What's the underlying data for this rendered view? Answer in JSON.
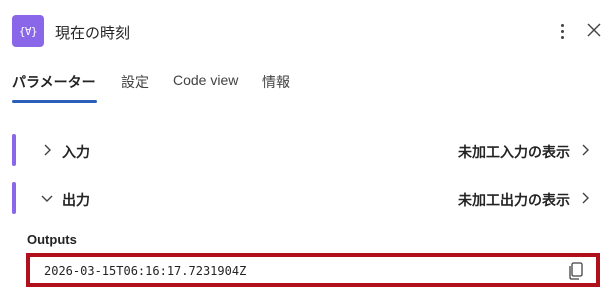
{
  "header": {
    "icon_text": "{∀}",
    "title": "現在の時刻"
  },
  "tabs": [
    {
      "label": "パラメーター",
      "active": true
    },
    {
      "label": "設定",
      "active": false
    },
    {
      "label": "Code view",
      "active": false
    },
    {
      "label": "情報",
      "active": false
    }
  ],
  "sections": {
    "input": {
      "label": "入力",
      "raw_link": "未加工入力の表示",
      "expanded": false
    },
    "output": {
      "label": "出力",
      "raw_link": "未加工出力の表示",
      "expanded": true
    }
  },
  "outputs": {
    "label": "Outputs",
    "value": "2026-03-15T06:16:17.7231904Z"
  },
  "colors": {
    "accent": "#8a66e8",
    "tab_underline": "#2b5fb9",
    "highlight_border": "#b0101c"
  },
  "icons": {
    "action": "expression-icon",
    "more": "more-vertical-icon",
    "close": "close-icon",
    "collapsed": "chevron-right-icon",
    "expanded": "chevron-down-icon",
    "copy": "copy-icon"
  }
}
